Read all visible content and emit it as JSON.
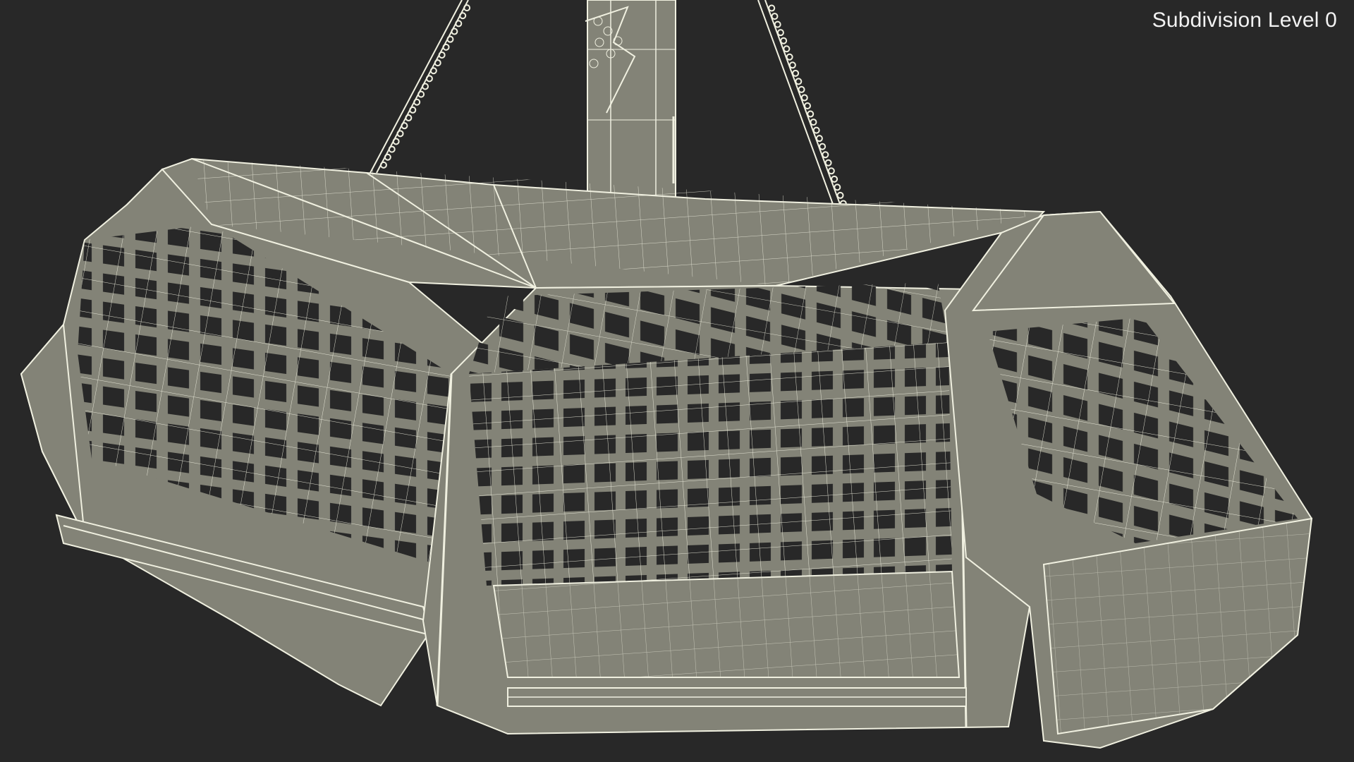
{
  "viewport": {
    "overlay_label": "Subdivision Level 0",
    "background_color": "#282828",
    "surface_color": "#838377",
    "wire_color": "#f0f0e0",
    "hole_color": "#282828"
  },
  "model": {
    "subject": "gondola-cabin-wireframe",
    "parts": [
      "support-pylon",
      "left-chain",
      "right-chain",
      "roof",
      "left-cage-section",
      "center-cage-section",
      "right-nose-section",
      "lower-hull",
      "bottom-rail"
    ]
  }
}
